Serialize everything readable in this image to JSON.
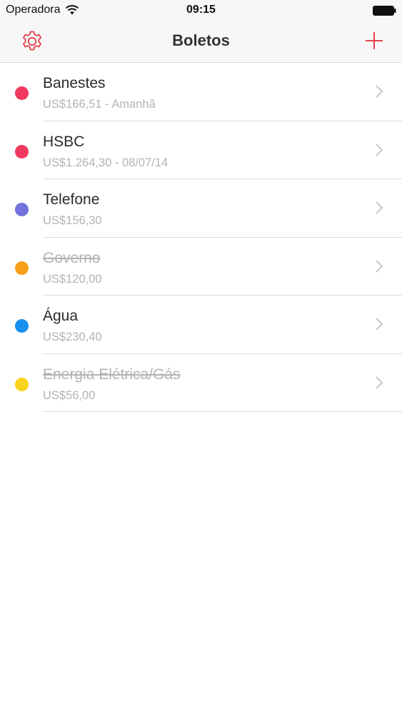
{
  "status_bar": {
    "carrier": "Operadora",
    "time": "09:15",
    "wifi_icon": "wifi-icon",
    "battery_icon": "battery-icon"
  },
  "nav": {
    "title": "Boletos",
    "settings_icon": "gear-icon",
    "add_icon": "plus-icon",
    "accent_color": "#e8414b"
  },
  "bills": [
    {
      "title": "Banestes",
      "subtitle": "US$166,51 - Amanhã",
      "color": "#f0395f",
      "done": false
    },
    {
      "title": "HSBC",
      "subtitle": "US$1.264,30 - 08/07/14",
      "color": "#f0395f",
      "done": false
    },
    {
      "title": "Telefone",
      "subtitle": "US$156,30",
      "color": "#7272dc",
      "done": false
    },
    {
      "title": "Governo",
      "subtitle": "US$120,00",
      "color": "#f6a01a",
      "done": true
    },
    {
      "title": "Água",
      "subtitle": "US$230,40",
      "color": "#1790f0",
      "done": false
    },
    {
      "title": "Energia Elétrica/Gás",
      "subtitle": "US$56,00",
      "color": "#f8d21b",
      "done": true
    }
  ]
}
